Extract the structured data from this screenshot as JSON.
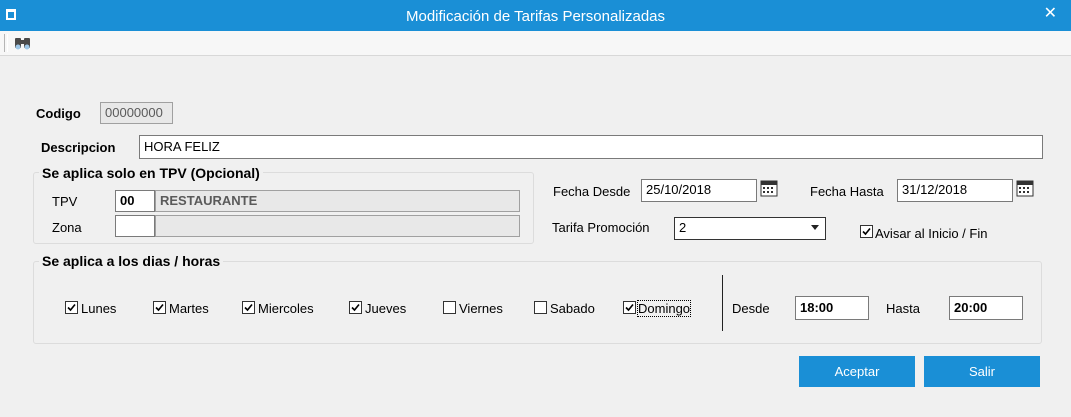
{
  "window": {
    "title": "Modificación de Tarifas Personalizadas"
  },
  "toolbar": {
    "search_icon": "binoculars-icon"
  },
  "form": {
    "codigo_label": "Codigo",
    "codigo_value": "00000000",
    "descripcion_label": "Descripcion",
    "descripcion_value": "HORA FELIZ"
  },
  "tpv_group": {
    "legend": "Se aplica solo en TPV (Opcional)",
    "tpv_label": "TPV",
    "tpv_code": "00",
    "tpv_name": "RESTAURANTE",
    "zona_label": "Zona",
    "zona_code": "",
    "zona_name": ""
  },
  "dates": {
    "desde_label": "Fecha Desde",
    "desde_value": "25/10/2018",
    "hasta_label": "Fecha Hasta",
    "hasta_value": "31/12/2018"
  },
  "promo": {
    "label": "Tarifa Promoción",
    "value": "2",
    "avisar_label": "Avisar al Inicio / Fin",
    "avisar_checked": true
  },
  "days_group": {
    "legend": "Se aplica a los dias / horas",
    "days": [
      {
        "label": "Lunes",
        "checked": true
      },
      {
        "label": "Martes",
        "checked": true
      },
      {
        "label": "Miercoles",
        "checked": true
      },
      {
        "label": "Jueves",
        "checked": true
      },
      {
        "label": "Viernes",
        "checked": false
      },
      {
        "label": "Sabado",
        "checked": false
      },
      {
        "label": "Domingo",
        "checked": true
      }
    ],
    "desde_label": "Desde",
    "desde_value": "18:00",
    "hasta_label": "Hasta",
    "hasta_value": "20:00"
  },
  "buttons": {
    "aceptar": "Aceptar",
    "salir": "Salir"
  },
  "colors": {
    "accent": "#1a8fd6",
    "background": "#f0f0f0"
  }
}
